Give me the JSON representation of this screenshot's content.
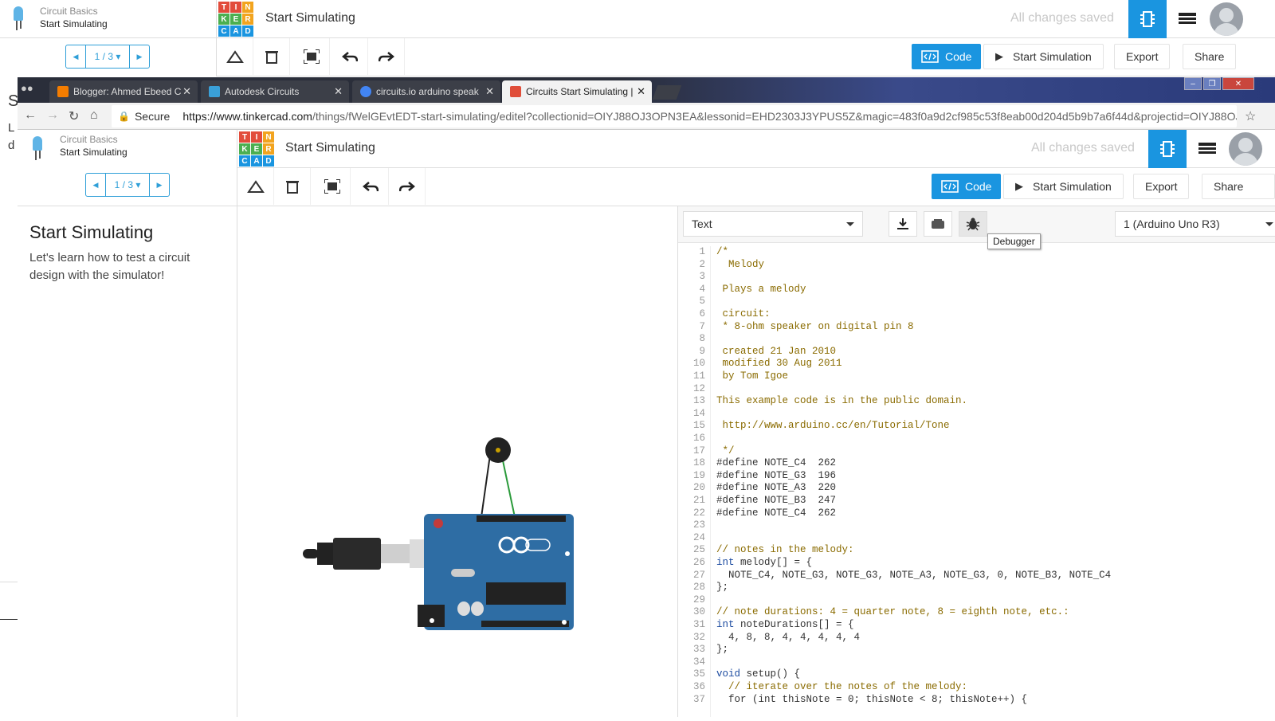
{
  "bg": {
    "course": "Circuit Basics",
    "lesson": "Start Simulating",
    "pager": "1 / 3",
    "title": "Start Simulating",
    "saved": "All changes saved",
    "code_label": "Code",
    "start_sim_label": "Start Simulation",
    "export_label": "Export",
    "share_label": "Share",
    "edge_letters": [
      "S",
      "L",
      "d"
    ]
  },
  "browser": {
    "tabs": [
      {
        "title": "Blogger: Ahmed Ebeed C",
        "color": "#f57d00"
      },
      {
        "title": "Autodesk Circuits",
        "color": "#3aa0d8"
      },
      {
        "title": "circuits.io arduino speak",
        "color": "#4285f4"
      },
      {
        "title": "Circuits Start Simulating |",
        "color": "#e04e39"
      }
    ],
    "secure_label": "Secure",
    "url_host": "https://www.tinkercad.com",
    "url_path": "/things/fWelGEvtEDT-start-simulating/editel?collectionid=OIYJ88OJ3OPN3EA&lessonid=EHD2303J3YPUS5Z&magic=483f0a9d2cf985c53f8eab00d204d5b9b7a6f44d&projectid=OIYJ88OJ..."
  },
  "inner": {
    "course": "Circuit Basics",
    "lesson": "Start Simulating",
    "pager": "1 / 3",
    "title": "Start Simulating",
    "saved": "All changes saved",
    "code_label": "Code",
    "start_sim_label": "Start Simulation",
    "export_label": "Export",
    "share_label": "Share",
    "step_title": "Start Simulating",
    "step_desc": "Let's learn how to test a circuit design with the simulator!",
    "logo_letters": [
      "T",
      "I",
      "N",
      "K",
      "E",
      "R",
      "C",
      "A",
      "D"
    ],
    "logo_colors": [
      "#e24c3b",
      "#e24c3b",
      "#f2a41f",
      "#4caf50",
      "#4caf50",
      "#f2a41f",
      "#1a95e0",
      "#1a95e0",
      "#1a95e0"
    ]
  },
  "code_editor": {
    "mode": "Text",
    "device": "1 (Arduino Uno R3)",
    "tooltip": "Debugger",
    "lines": [
      "/*",
      "  Melody",
      "",
      " Plays a melody",
      "",
      " circuit:",
      " * 8-ohm speaker on digital pin 8",
      "",
      " created 21 Jan 2010",
      " modified 30 Aug 2011",
      " by Tom Igoe",
      "",
      "This example code is in the public domain.",
      "",
      " http://www.arduino.cc/en/Tutorial/Tone",
      "",
      " */",
      "#define NOTE_C4  262",
      "#define NOTE_G3  196",
      "#define NOTE_A3  220",
      "#define NOTE_B3  247",
      "#define NOTE_C4  262",
      "",
      "",
      "// notes in the melody:",
      "int melody[] = {",
      "  NOTE_C4, NOTE_G3, NOTE_G3, NOTE_A3, NOTE_G3, 0, NOTE_B3, NOTE_C4",
      "};",
      "",
      "// note durations: 4 = quarter note, 8 = eighth note, etc.:",
      "int noteDurations[] = {",
      "  4, 8, 8, 4, 4, 4, 4, 4",
      "};",
      "",
      "void setup() {",
      "  // iterate over the notes of the melody:",
      "  for (int thisNote = 0; thisNote < 8; thisNote++) {"
    ],
    "comment_lines": [
      1,
      2,
      3,
      4,
      5,
      6,
      7,
      8,
      9,
      10,
      11,
      12,
      13,
      14,
      15,
      16,
      17,
      25,
      30,
      36
    ],
    "keyword_lines": [
      26,
      31,
      35
    ]
  },
  "colors": {
    "accent": "#1a95e0",
    "board": "#2e6da4"
  }
}
